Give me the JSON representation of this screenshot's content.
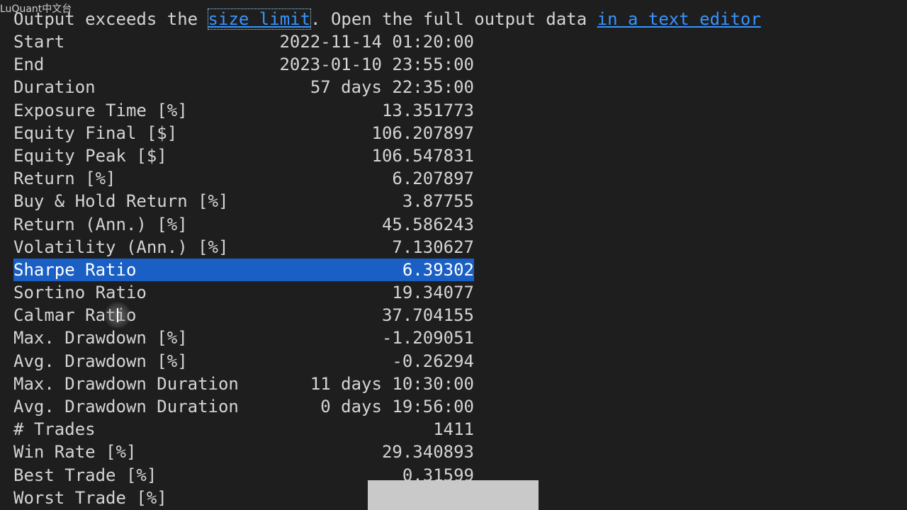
{
  "watermark": "LuQuant中文台",
  "notice": {
    "prefix": "Output exceeds the ",
    "link1": "size limit",
    "middle": ". Open the full output data ",
    "link2": "in a text editor"
  },
  "stats": [
    {
      "label": "Start",
      "value": "2022-11-14 01:20:00"
    },
    {
      "label": "End",
      "value": "2023-01-10 23:55:00"
    },
    {
      "label": "Duration",
      "value": "57 days 22:35:00"
    },
    {
      "label": "Exposure Time [%]",
      "value": "13.351773"
    },
    {
      "label": "Equity Final [$]",
      "value": "106.207897"
    },
    {
      "label": "Equity Peak [$]",
      "value": "106.547831"
    },
    {
      "label": "Return [%]",
      "value": "6.207897"
    },
    {
      "label": "Buy & Hold Return [%]",
      "value": "3.87755"
    },
    {
      "label": "Return (Ann.) [%]",
      "value": "45.586243"
    },
    {
      "label": "Volatility (Ann.) [%]",
      "value": "7.130627"
    },
    {
      "label": "Sharpe Ratio",
      "value": "6.39302"
    },
    {
      "label": "Sortino Ratio",
      "value": "19.34077"
    },
    {
      "label": "Calmar Ratio",
      "value": "37.704155"
    },
    {
      "label": "Max. Drawdown [%]",
      "value": "-1.209051"
    },
    {
      "label": "Avg. Drawdown [%]",
      "value": "-0.26294"
    },
    {
      "label": "Max. Drawdown Duration",
      "value": "11 days 10:30:00"
    },
    {
      "label": "Avg. Drawdown Duration",
      "value": "0 days 19:56:00"
    },
    {
      "label": "# Trades",
      "value": "1411"
    },
    {
      "label": "Win Rate [%]",
      "value": "29.340893"
    },
    {
      "label": "Best Trade [%]",
      "value": "0.31599"
    },
    {
      "label": "Worst Trade [%]",
      "value": ""
    }
  ],
  "selected_row": "Sharpe Ratio",
  "colors": {
    "background": "#1e1e1e",
    "text": "#d4d4d4",
    "link": "#3794ff",
    "selection": "#1a5fc4"
  }
}
